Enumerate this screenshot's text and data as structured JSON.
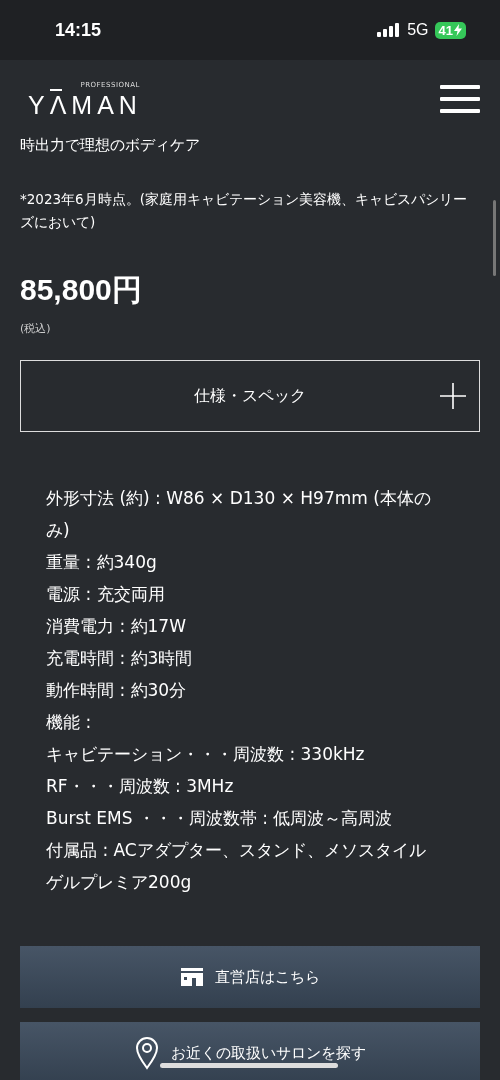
{
  "status_bar": {
    "time": "14:15",
    "network": "5G",
    "battery": "41",
    "charging": true
  },
  "header": {
    "logo": "YΛMAN",
    "logo_sub": "PROFESSIONAL"
  },
  "tagline": "時出力で理想のボディケア",
  "footnote": "*2023年6月時点。(家庭用キャビテーション美容機、キャビスパシリーズにおいて)",
  "price": "85,800円",
  "tax_note": "(税込)",
  "spec_toggle": {
    "label": "仕様・スペック",
    "expanded": false
  },
  "specs": [
    "外形寸法 (約) : W86 × D130 × H97mm (本体のみ)",
    "重量 : 約340g",
    "電源 : 充交両用",
    "消費電力 : 約17W",
    "充電時間 : 約3時間",
    "動作時間 : 約30分",
    "機能 :",
    "キャビテーション・・・周波数 : 330kHz",
    "RF・・・周波数 : 3MHz",
    "Burst EMS ・・・周波数帯 : 低周波～高周波",
    "付属品 : ACアダプター、スタンド、メソスタイルゲルプレミア200g"
  ],
  "buttons": [
    {
      "label": "直営店はこちら",
      "kind": "store"
    },
    {
      "label": "お近くの取扱いサロンを探す",
      "kind": "pin"
    }
  ]
}
